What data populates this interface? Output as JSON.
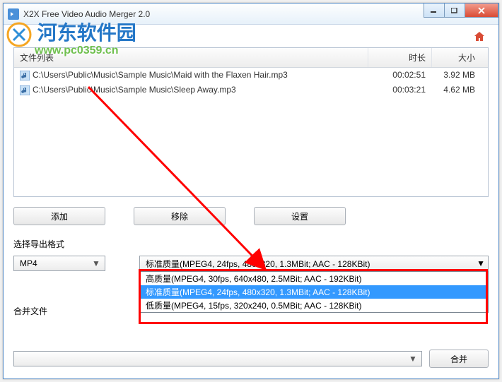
{
  "window": {
    "title": "X2X Free Video Audio Merger 2.0"
  },
  "watermark": {
    "text": "河东软件园",
    "url": "www.pc0359.cn"
  },
  "fileList": {
    "headers": {
      "name": "文件列表",
      "duration": "时长",
      "size": "大小"
    },
    "rows": [
      {
        "path": "C:\\Users\\Public\\Music\\Sample Music\\Maid with the Flaxen Hair.mp3",
        "duration": "00:02:51",
        "size": "3.92 MB"
      },
      {
        "path": "C:\\Users\\Public\\Music\\Sample Music\\Sleep Away.mp3",
        "duration": "00:03:21",
        "size": "4.62 MB"
      }
    ]
  },
  "buttons": {
    "add": "添加",
    "remove": "移除",
    "settings": "设置",
    "merge": "合并"
  },
  "labels": {
    "outputFormat": "选择导出格式",
    "mergeFile": "合并文件"
  },
  "format": {
    "selected": "MP4"
  },
  "quality": {
    "selected": "标准质量(MPEG4,  24fps,  480x320,  1.3MBit;   AAC - 128KBit)",
    "options": [
      "高质量(MPEG4,  30fps,  640x480,  2.5MBit;   AAC - 192KBit)",
      "标准质量(MPEG4,  24fps,  480x320,  1.3MBit;   AAC - 128KBit)",
      "低质量(MPEG4,  15fps,  320x240,  0.5MBit;   AAC - 128KBit)"
    ]
  }
}
